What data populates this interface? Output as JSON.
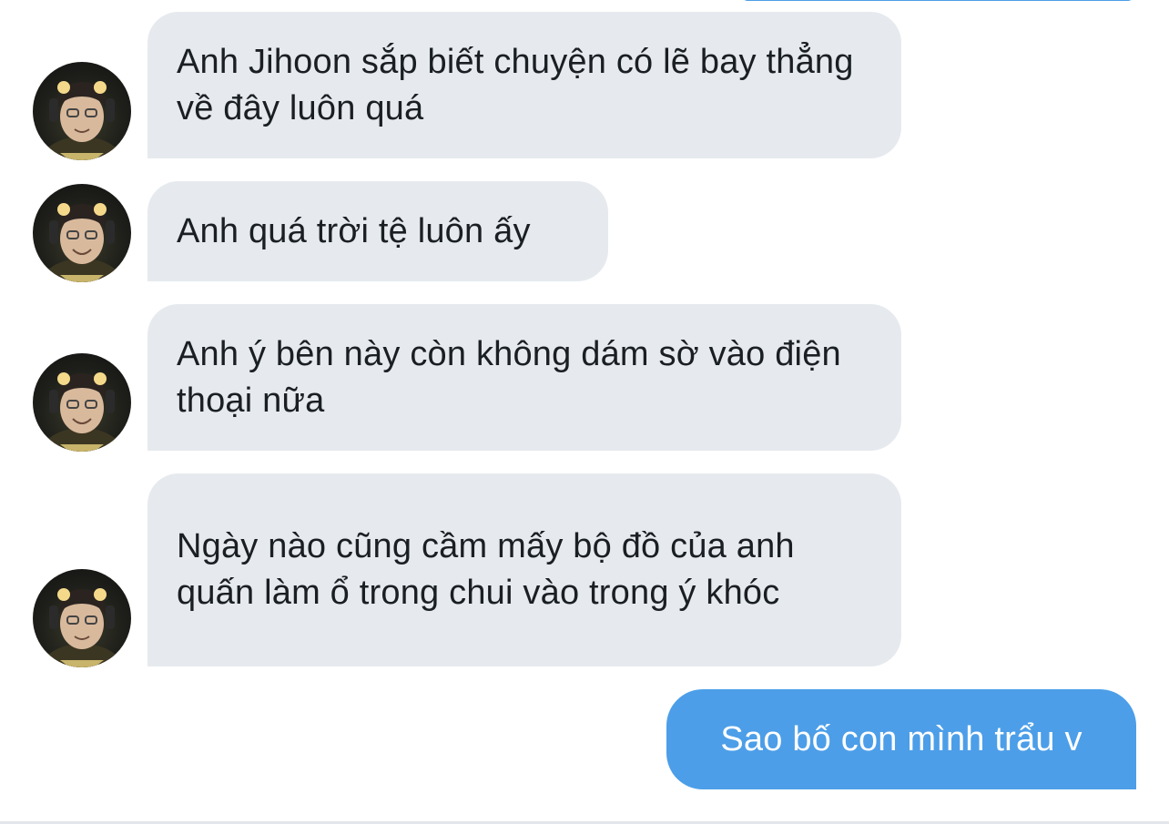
{
  "conversation": {
    "messages": [
      {
        "direction": "received",
        "text": "Anh Jihoon sắp biết chuyện có lẽ bay thẳng về đây luôn quá",
        "avatar": "user-avatar"
      },
      {
        "direction": "received",
        "text": "Anh quá trời tệ luôn ấy",
        "avatar": "user-avatar"
      },
      {
        "direction": "received",
        "text": "Anh ý bên này còn không dám sờ vào điện thoại nữa",
        "avatar": "user-avatar"
      },
      {
        "direction": "received",
        "text": "Ngày nào cũng cầm mấy bộ đồ của anh quấn làm ổ trong chui vào trong ý khóc",
        "avatar": "user-avatar"
      },
      {
        "direction": "sent",
        "text": "Sao bố con mình trẩu v"
      }
    ]
  },
  "colors": {
    "received_bubble": "#e6eaee",
    "received_text": "#1a1f24",
    "sent_bubble": "#4c9ee8",
    "sent_text": "#ffffff"
  }
}
